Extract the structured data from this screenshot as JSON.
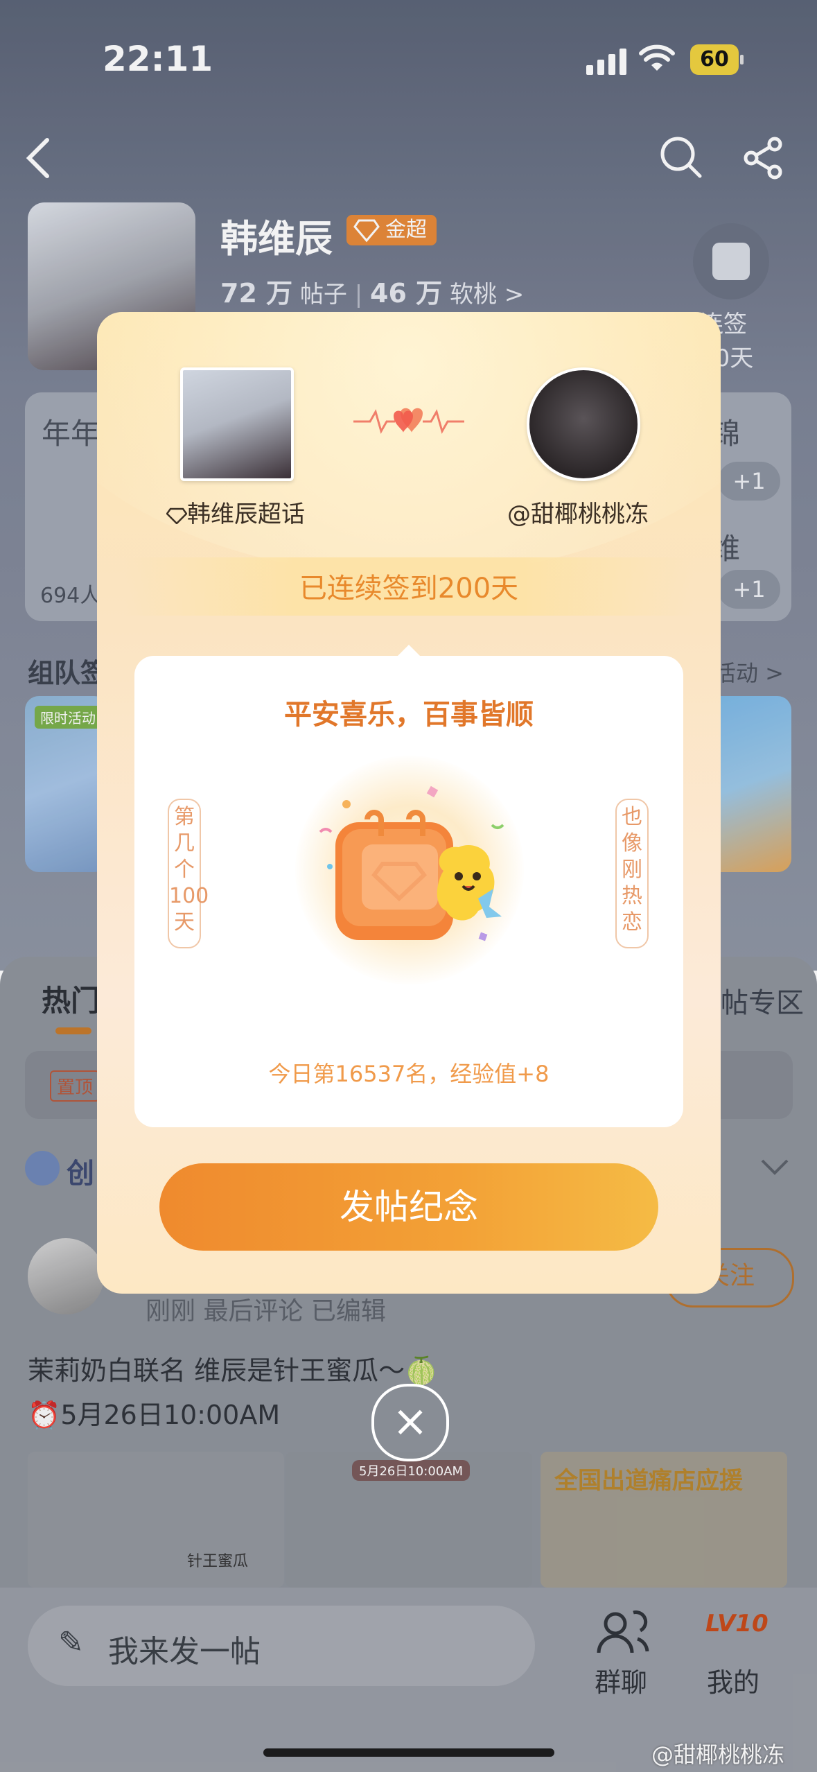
{
  "status_bar": {
    "time": "22:11",
    "battery": "60"
  },
  "topic": {
    "name": "韩维辰",
    "badge": "金超",
    "posts_count": "72 万",
    "posts_label": "帖子",
    "fans_count": "46 万",
    "fans_label": "软桃 >",
    "checkin_label_1": "连签",
    "checkin_label_2": "00天"
  },
  "background": {
    "card_left_title": "年年",
    "card_left_count": "694人",
    "card_right_title_1": "锦",
    "card_right_title_2": "维",
    "plus_one": "+1",
    "section_title": "组队签",
    "section_more": "活动 >",
    "banner_tag": "限时活动",
    "tab_hot": "热门",
    "tab_right": "帖专区",
    "pin_badge": "置顶",
    "row_label": "创",
    "post_meta": "刚刚  最后评论    已编辑",
    "follow": "关注",
    "post_title": "茉莉奶白联名 维辰是针王蜜瓜～🍈",
    "post_time": "⏰5月26日10:00AM",
    "thumb_mid_tag": "5月26日10:00AM",
    "thumb_right_title": "全国出道痛店应援",
    "thumb_left_caption": "针王蜜瓜"
  },
  "modal": {
    "left_name": "韩维辰超话",
    "right_name": "@甜椰桃桃冻",
    "streak_text": "已连续签到200天",
    "blessing": "平安喜乐，百事皆顺",
    "left_scroll": "第几个100天",
    "right_scroll": "也像刚热恋",
    "rank_text": "今日第16537名，经验值+8",
    "post_button": "发帖纪念"
  },
  "bottom_bar": {
    "compose_placeholder": "我来发一帖",
    "group_chat": "群聊",
    "mine": "我的",
    "level": "LV10"
  },
  "watermark": "@甜椰桃桃冻",
  "colors": {
    "accent": "#ef8a2e",
    "streak": "#e8892c",
    "blessing": "#e1772a"
  },
  "icons": [
    "back-icon",
    "search-icon",
    "share-icon",
    "calendar-icon",
    "heart-icon",
    "diamond-icon",
    "pencil-icon",
    "group-chat-icon",
    "profile-icon",
    "close-icon",
    "chevron-down-icon"
  ]
}
